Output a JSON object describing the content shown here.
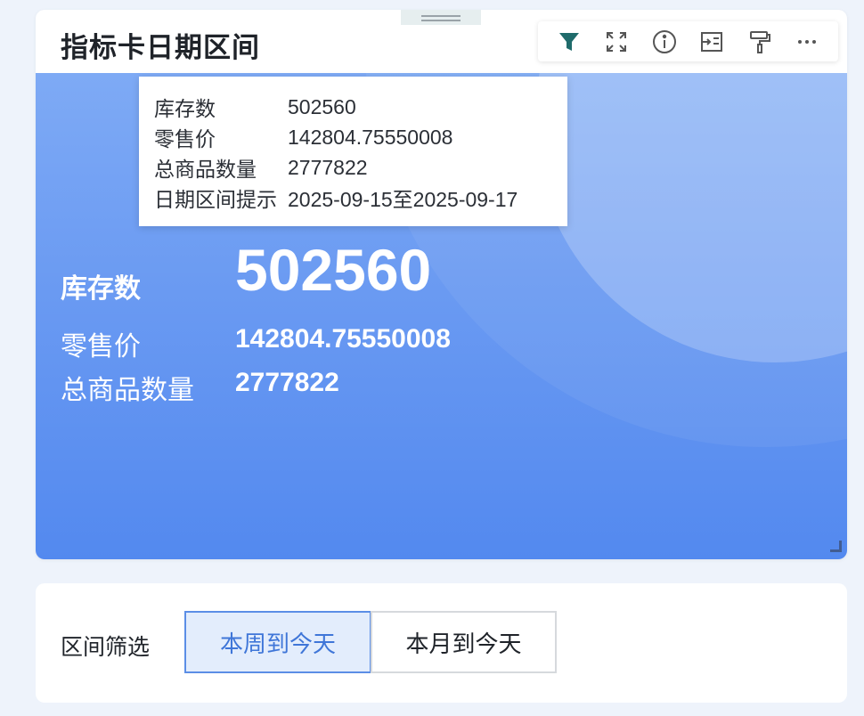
{
  "card": {
    "title": "指标卡日期区间",
    "toolbar": {
      "icons": [
        "filter-icon",
        "fullscreen-icon",
        "info-icon",
        "export-icon",
        "format-brush-icon",
        "more-icon"
      ],
      "accent": "#1f6b6b"
    },
    "metrics": {
      "primary": {
        "label": "库存数",
        "value": "502560"
      },
      "secondary": [
        {
          "label": "零售价",
          "value": "142804.75550008"
        },
        {
          "label": "总商品数量",
          "value": "2777822"
        }
      ]
    },
    "background_colors": {
      "top": "#7eaaf5",
      "bottom": "#5389ef"
    }
  },
  "tooltip": {
    "rows": [
      {
        "key": "库存数",
        "value": "502560"
      },
      {
        "key": "零售价",
        "value": "142804.75550008"
      },
      {
        "key": "总商品数量",
        "value": "2777822"
      },
      {
        "key": "日期区间提示",
        "value": "2025-09-15至2025-09-17"
      }
    ]
  },
  "filter": {
    "label": "区间筛选",
    "options": [
      {
        "label": "本周到今天",
        "selected": true
      },
      {
        "label": "本月到今天",
        "selected": false
      }
    ],
    "active_color": "#3f76d8"
  }
}
